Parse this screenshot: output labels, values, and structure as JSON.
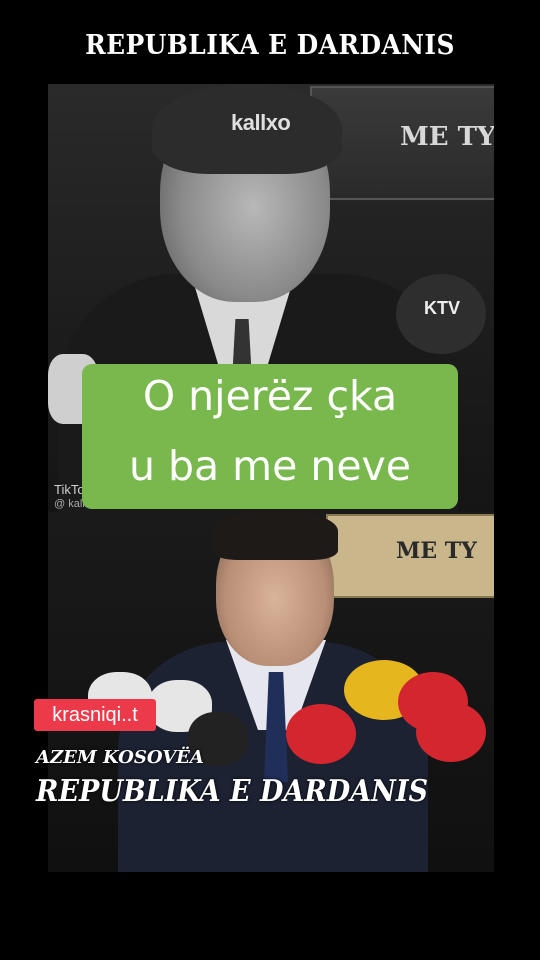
{
  "header": {
    "title": "REPUBLIKA E DARDANIS"
  },
  "top_photo": {
    "watermark": "kallxo",
    "backdrop_sign": "ME TY",
    "mic_logo": "KTV",
    "tiktok_label": "TikTok",
    "tiktok_handle": "@ kallxo"
  },
  "caption": {
    "line1": "O njerëz çka",
    "line2": "u ba me neve"
  },
  "bottom_photo": {
    "backdrop_sign": "ME TY"
  },
  "overlay": {
    "account": "krasniqi..t",
    "subtitle": "AZEM KOSOVËA",
    "title": "REPUBLIKA E DARDANIS"
  },
  "colors": {
    "caption_bg": "#79b84d",
    "badge_bg": "#ed3a4a",
    "background": "#000000"
  }
}
